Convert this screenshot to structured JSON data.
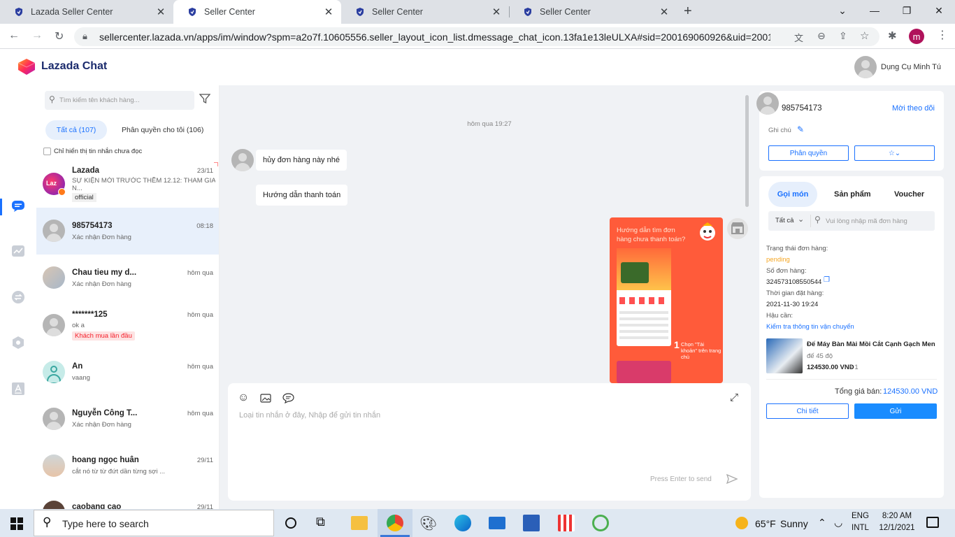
{
  "browser": {
    "tabs": [
      {
        "title": "Lazada Seller Center",
        "active": false
      },
      {
        "title": "Seller Center",
        "active": true
      },
      {
        "title": "Seller Center",
        "active": false
      },
      {
        "title": "Seller Center",
        "active": false
      }
    ],
    "new_tab": "+",
    "url": "sellercenter.lazada.vn/apps/im/window?spm=a2o7f.10605556.seller_layout_icon_list.dmessage_chat_icon.13fa1e13leULXA#sid=200169060926&uid=2001690...",
    "profile_initial": "m"
  },
  "app": {
    "logo_text": "Lazada Chat",
    "user_name": "Dụng Cụ Minh Tú"
  },
  "list": {
    "search_placeholder": "Tìm kiếm tên khách hàng...",
    "tab_all": "Tất cả (107)",
    "tab_assigned": "Phân quyền cho tôi (106)",
    "unread_only": "Chỉ hiển thị tin nhắn chưa đọc",
    "items": [
      {
        "name": "Lazada",
        "time": "23/11",
        "preview": "SỰ KIỆN MỜI TRƯỚC THỀM 12.12: THAM GIA",
        "preview2": "N...",
        "tag": "official",
        "avatar_text": "Laz"
      },
      {
        "name": "985754173",
        "time": "08:18",
        "preview": "Xác nhận Đơn hàng"
      },
      {
        "name": "Chau tieu my d...",
        "time": "hôm qua",
        "preview": "Xác nhận Đơn hàng"
      },
      {
        "name": "*******125",
        "time": "hôm qua",
        "preview": "ok a",
        "tag": "Khách mua lần đầu"
      },
      {
        "name": "An",
        "time": "hôm qua",
        "preview": "vaang"
      },
      {
        "name": "Nguyễn Công T...",
        "time": "hôm qua",
        "preview": "Xác nhận Đơn hàng"
      },
      {
        "name": "hoang ngọc huân",
        "time": "29/11",
        "preview": "cắt nó từ từ đứt dần từng sợi ..."
      },
      {
        "name": "caobang cao",
        "time": "29/11",
        "preview": ""
      }
    ]
  },
  "chat": {
    "date_divider": "hôm qua 19:27",
    "messages": [
      "hủy đơn hàng này nhé",
      "Hướng dẫn thanh toán"
    ],
    "image_caption": "Hướng dẫn tìm đơn hàng chưa thanh toán?",
    "image_hint": "Chọn \"Tài khoản\" trên trang chủ",
    "image_step": "1",
    "composer_placeholder": "Loại tin nhắn ở đây, Nhập để gửi tin nhắn",
    "send_hint": "Press Enter to send"
  },
  "customer": {
    "id": "985754173",
    "follow": "Mời theo dõi",
    "note_label": "Ghi chú",
    "assign_btn": "Phân quyền",
    "star_btn": "☆⌄"
  },
  "order": {
    "tabs": [
      "Gọi món",
      "Sản phẩm",
      "Voucher"
    ],
    "filter": "Tất cả",
    "search_placeholder": "Vui lòng nhập mã đơn hàng",
    "status_label": "Trạng thái đơn hàng:",
    "status_value": "pending",
    "number_label": "Số đơn hàng:",
    "number_value": "324573108550544",
    "time_label": "Thời gian đặt hàng:",
    "time_value": "2021-11-30 19:24",
    "logistics_label": "Hậu cần:",
    "logistics_link": "Kiểm tra thông tin vận chuyển",
    "product_name": "Đế Máy Bàn Mài Mồi Cắt Cạnh Gạch Men - ...",
    "product_variant": "đế 45 độ",
    "product_price": "124530.00 VND",
    "product_qty": "x 1",
    "total_label": "Tổng giá bán:",
    "total_value": "124530.00 VND",
    "detail_btn": "Chi tiết",
    "send_btn": "Gửi"
  },
  "taskbar": {
    "search_placeholder": "Type here to search",
    "weather_temp": "65°F",
    "weather_desc": "Sunny",
    "lang1": "ENG",
    "lang2": "INTL",
    "time": "8:20 AM",
    "date": "12/1/2021"
  },
  "colors": {
    "accent": "#1a71ff",
    "pending": "#f5a623",
    "tag_red": "#f5222d"
  }
}
